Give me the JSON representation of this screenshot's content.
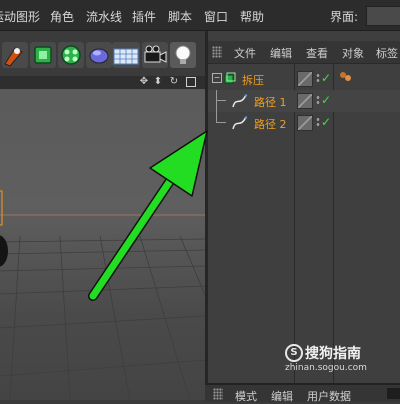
{
  "menubar": {
    "items": [
      "运动图形",
      "角色",
      "流水线",
      "插件",
      "脚本",
      "窗口",
      "帮助"
    ],
    "layout_label": "界面:"
  },
  "toolbar": {
    "icons": [
      "spline-pen-icon",
      "cube-generator-icon",
      "mograph-cloner-icon",
      "deformer-icon",
      "floor-grid-icon",
      "camera-icon",
      "light-bulb-icon"
    ]
  },
  "viewport": {
    "nav_icons": [
      "move-view-icon",
      "zoom-view-icon",
      "rotate-view-icon",
      "maximize-view-icon"
    ]
  },
  "object_manager": {
    "menu": [
      "文件",
      "编辑",
      "查看",
      "对象",
      "标签"
    ],
    "objects": [
      {
        "name": "拆压",
        "type": "extrude",
        "level": 0
      },
      {
        "name": "路径 1",
        "type": "spline",
        "level": 1
      },
      {
        "name": "路径 2",
        "type": "spline",
        "level": 1
      }
    ]
  },
  "attribute_manager": {
    "menu": [
      "模式",
      "编辑",
      "用户数据"
    ]
  },
  "watermark": {
    "logo": "S",
    "title": "搜狗指南",
    "url": "zhinan.sogou.com"
  },
  "colors": {
    "object_name": "#f0a020",
    "check": "#3fe03f",
    "annotation_arrow": "#22dd22"
  }
}
